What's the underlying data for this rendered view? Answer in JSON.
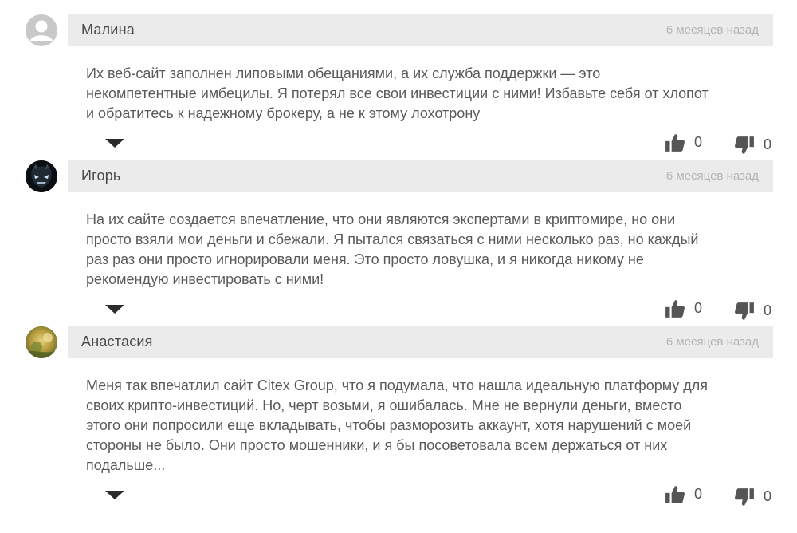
{
  "comments": [
    {
      "author": "Малина",
      "time": "6 месяцев назад",
      "avatar": "default-user",
      "text_lines": [
        "Их веб-сайт заполнен липовыми обещаниями, а их служба поддержки — это",
        "некомпетентные имбецилы. Я потерял все свои инвестиции с ними! Избавьте себя от хлопот",
        "и обратитесь к надежному брокеру, а не к этому лохотрону"
      ],
      "likes": "0",
      "dislikes": "0"
    },
    {
      "author": "Игорь",
      "time": "6 месяцев назад",
      "avatar": "dark-mask",
      "text_lines": [
        "На их сайте создается впечатление, что они являются экспертами в криптомире, но они",
        "просто взяли мои деньги и сбежали. Я пытался связаться с ними несколько раз, но каждый",
        "раз раз они просто игнорировали меня. Это просто ловушка, и я никогда никому не",
        "рекомендую инвестировать с ними!"
      ],
      "likes": "0",
      "dislikes": "0"
    },
    {
      "author": "Анастасия",
      "time": "6 месяцев назад",
      "avatar": "nature-photo",
      "text_lines": [
        "Меня так впечатлил сайт Citex Group, что я подумала, что нашла идеальную платформу для",
        "своих крипто-инвестиций. Но, черт возьми, я ошибалась. Мне не вернули деньги, вместо",
        "этого они попросили еще вкладывать, чтобы разморозить аккаунт, хотя нарушений с моей",
        "стороны не было. Они просто мошенники, и я бы посоветовала всем держаться от них",
        "подальше..."
      ],
      "likes": "0",
      "dislikes": "0"
    }
  ],
  "icons": {
    "like": "thumbs-up-icon",
    "dislike": "thumbs-down-icon",
    "expand": "caret-down-icon"
  },
  "colors": {
    "header_bg": "#ebebeb",
    "text": "#5a5a5a",
    "icon": "#555555"
  }
}
